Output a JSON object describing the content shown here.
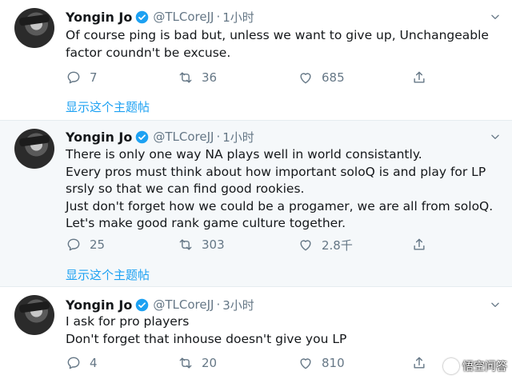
{
  "tweets": [
    {
      "name": "Yongin Jo",
      "handle": "@TLCoreJJ",
      "separator": "·",
      "time": "1小时",
      "lines": [
        "Of course ping is bad but, unless we want to give up, Unchangeable",
        "factor coundn't be excuse."
      ],
      "replies": "7",
      "retweets": "36",
      "likes": "685",
      "thread_link": "显示这个主题帖"
    },
    {
      "name": "Yongin Jo",
      "handle": "@TLCoreJJ",
      "separator": "·",
      "time": "1小时",
      "lines": [
        "There is only one way NA plays well in world consistantly.",
        "Every pros must think about how important soloQ is and play for LP",
        "srsly so that we can find good rookies.",
        "Just don't forget how we could be a progamer, we are all from soloQ.",
        "Let's make good rank game culture together."
      ],
      "replies": "25",
      "retweets": "303",
      "likes": "2.8千",
      "thread_link": "显示这个主题帖"
    },
    {
      "name": "Yongin Jo",
      "handle": "@TLCoreJJ",
      "separator": "·",
      "time": "3小时",
      "lines": [
        "I ask for pro players",
        "Don't forget that inhouse doesn't give you LP"
      ],
      "replies": "4",
      "retweets": "20",
      "likes": "810"
    }
  ],
  "watermark": {
    "text": "悟空问答"
  },
  "colors": {
    "link": "#1da1f2",
    "muted": "#657786",
    "text": "#14171a",
    "highlight_bg": "#f5f8fa",
    "verified": "#1da1f2"
  }
}
